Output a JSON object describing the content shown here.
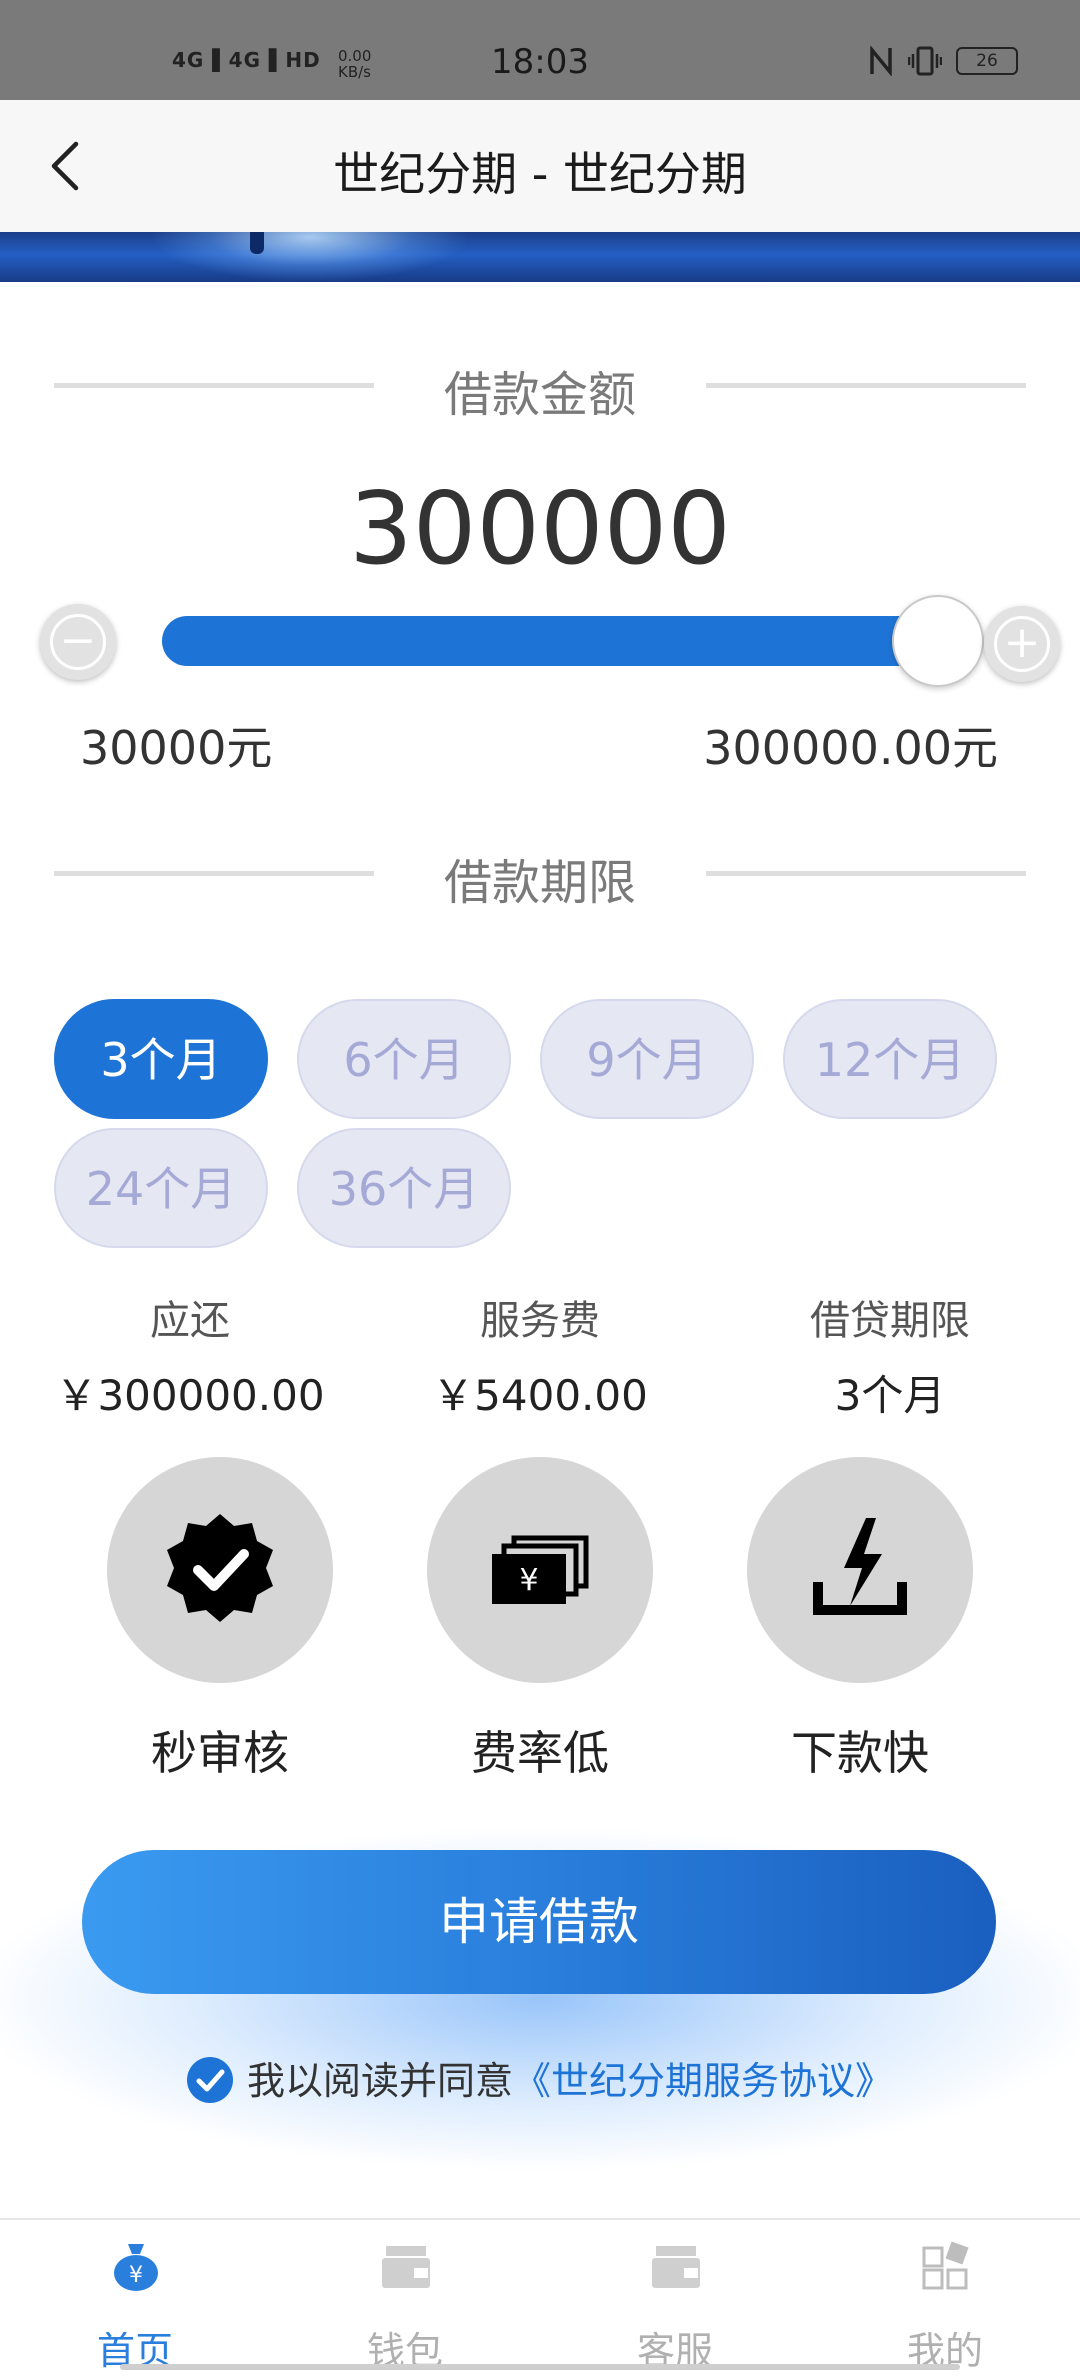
{
  "status_bar": {
    "time": "18:03",
    "signal": "4G▐ 4G▐ HD",
    "speed_top": "0.00",
    "speed_bottom": "KB/s",
    "battery": "26"
  },
  "header": {
    "title": "世纪分期 - 世纪分期",
    "back_icon": "chevron-left-icon"
  },
  "amount_section": {
    "title": "借款金额",
    "amount": "300000",
    "min_label": "30000元",
    "max_label": "300000.00元",
    "slider_fraction": 1.0
  },
  "term_section": {
    "title": "借款期限",
    "options": [
      "3个月",
      "6个月",
      "9个月",
      "12个月",
      "24个月",
      "36个月"
    ],
    "selected_index": 0
  },
  "summary": [
    {
      "label": "应还",
      "value": "￥300000.00"
    },
    {
      "label": "服务费",
      "value": "￥5400.00"
    },
    {
      "label": "借贷期限",
      "value": "3个月"
    }
  ],
  "features": [
    {
      "label": "秒审核",
      "icon": "verified-badge-icon"
    },
    {
      "label": "费率低",
      "icon": "cash-stack-icon"
    },
    {
      "label": "下款快",
      "icon": "lightning-icon"
    }
  ],
  "apply": {
    "button_label": "申请借款",
    "agree_text": "我以阅读并同意",
    "agreement_link": "《世纪分期服务协议》",
    "agreed": true
  },
  "bottom_nav": [
    {
      "label": "首页",
      "icon": "money-bag-icon",
      "active": true
    },
    {
      "label": "钱包",
      "icon": "wallet-icon",
      "active": false
    },
    {
      "label": "客服",
      "icon": "customer-service-icon",
      "active": false
    },
    {
      "label": "我的",
      "icon": "grid-apps-icon",
      "active": false
    }
  ],
  "colors": {
    "primary": "#1e74d6",
    "chip_inactive_bg": "#e5e7f3",
    "chip_inactive_text": "#a5a9d6"
  }
}
